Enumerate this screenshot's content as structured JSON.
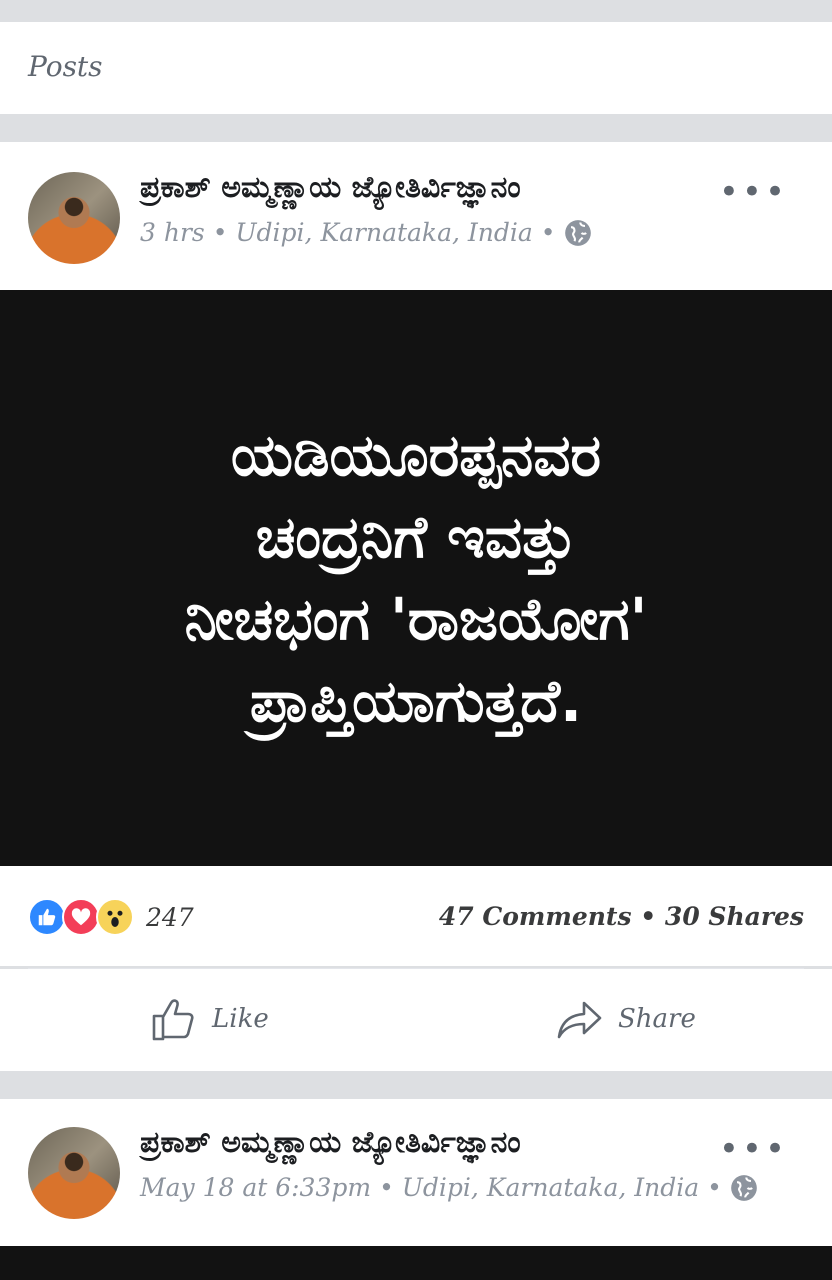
{
  "section": {
    "title": "Posts"
  },
  "posts": [
    {
      "author": "ಪ್ರಕಾಶ್ ಅಮ್ಮಣ್ಣಾಯ ಜ್ಯೋತಿರ್ವಿಜ್ಞಾನಂ",
      "time": "3 hrs",
      "location": "Udipi, Karnataka, India",
      "separator": "•",
      "privacy_icon": "globe-icon",
      "more_label": "•••",
      "media_lines": [
        "ಯಡಿಯೂರಪ್ಪನವರ",
        "ಚಂದ್ರನಿಗೆ ಇವತ್ತು",
        "ನೀಚಭಂಗ 'ರಾಜಯೋಗ'",
        "ಪ್ರಾಪ್ತಿಯಾಗುತ್ತದೆ."
      ],
      "reactions": [
        "like-reaction-icon",
        "love-reaction-icon",
        "wow-reaction-icon"
      ],
      "reaction_count": "247",
      "comments_shares": "47 Comments • 30 Shares",
      "like_label": "Like",
      "share_label": "Share"
    },
    {
      "author": "ಪ್ರಕಾಶ್ ಅಮ್ಮಣ್ಣಾಯ ಜ್ಯೋತಿರ್ವಿಜ್ಞಾನಂ",
      "time": "May 18 at 6:33pm",
      "location": "Udipi, Karnataka, India",
      "separator": "•",
      "privacy_icon": "globe-icon",
      "more_label": "•••"
    }
  ],
  "colors": {
    "background": "#dddfe2",
    "card": "#ffffff",
    "media_bg": "#121212",
    "meta_text": "#8d949e",
    "like_blue": "#2d88ff",
    "love_red": "#f33e58",
    "wow_yellow": "#f7d35a"
  }
}
